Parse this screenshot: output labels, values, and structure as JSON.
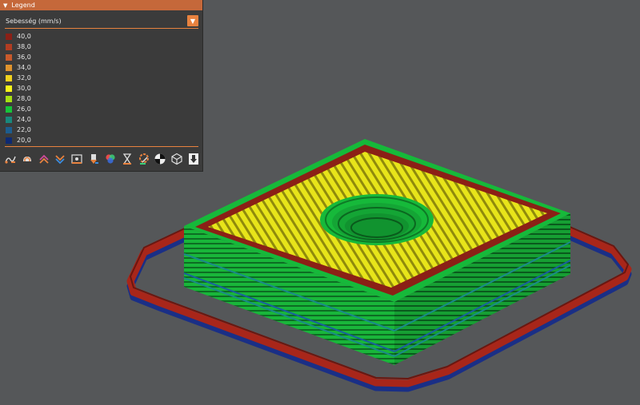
{
  "legend": {
    "title": "Legend",
    "view_type": "Sebesség (mm/s)",
    "items": [
      {
        "label": "40,0",
        "color": "#8b2016"
      },
      {
        "label": "38,0",
        "color": "#b13d22"
      },
      {
        "label": "36,0",
        "color": "#c85a2c"
      },
      {
        "label": "34,0",
        "color": "#e0942e"
      },
      {
        "label": "32,0",
        "color": "#f1d21e"
      },
      {
        "label": "30,0",
        "color": "#f6f41a"
      },
      {
        "label": "28,0",
        "color": "#a7e013"
      },
      {
        "label": "26,0",
        "color": "#17c33a"
      },
      {
        "label": "24,0",
        "color": "#18887c"
      },
      {
        "label": "22,0",
        "color": "#1c5d8e"
      },
      {
        "label": "20,0",
        "color": "#0e2a72"
      }
    ],
    "tools": [
      "travel-moves-icon",
      "wipe-icon",
      "retractions-icon",
      "deretractions-icon",
      "seams-icon",
      "tool-changes-icon",
      "color-changes-icon",
      "pause-prints-icon",
      "custom-gcodes-icon",
      "center-of-gravity-icon",
      "shells-icon",
      "tool-marker-icon"
    ]
  },
  "colors": {
    "background": "#555759",
    "accent": "#e8823f",
    "extrusion_green": "#17c33a",
    "extrusion_yellow": "#f6f41a",
    "extrusion_red": "#8b2016",
    "extrusion_blue": "#1c5d8e"
  }
}
